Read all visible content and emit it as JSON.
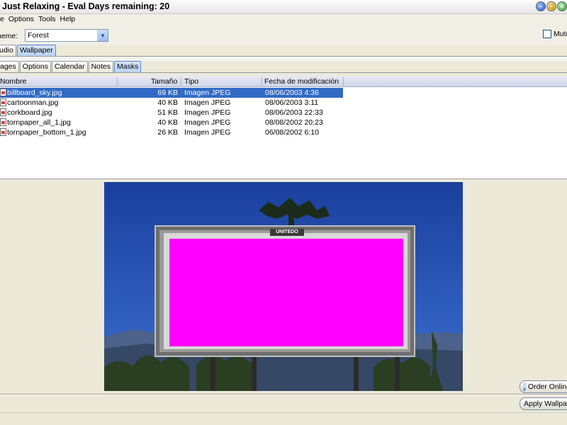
{
  "window": {
    "title": "Just Relaxing - Eval Days remaining: 20",
    "controls": {
      "minimize": "–",
      "maximize": "□",
      "close": "×"
    }
  },
  "menu": [
    {
      "label": "e",
      "accel": ""
    },
    {
      "label": "Options",
      "accel": "O"
    },
    {
      "label": "Tools",
      "accel": "T"
    },
    {
      "label": "Help",
      "accel": "H"
    }
  ],
  "theme": {
    "label": "heme:",
    "value": "Forest"
  },
  "mute": {
    "label": "Mute",
    "checked": false
  },
  "main_tabs": [
    {
      "label": "udio",
      "active": false
    },
    {
      "label": "Wallpaper",
      "active": true
    }
  ],
  "sub_tabs": [
    {
      "label": "ages",
      "active": false
    },
    {
      "label": "Options",
      "active": false
    },
    {
      "label": "Calendar",
      "active": false
    },
    {
      "label": "Notes",
      "active": false
    },
    {
      "label": "Masks",
      "active": true
    }
  ],
  "file_list": {
    "columns": {
      "name": "Nombre",
      "size": "Tamaño",
      "type": "Tipo",
      "modified": "Fecha de modificación"
    },
    "rows": [
      {
        "name": "billboard_sky.jpg",
        "size": "69 KB",
        "type": "Imagen JPEG",
        "modified": "08/06/2003 4:36",
        "selected": true
      },
      {
        "name": "cartoonman.jpg",
        "size": "40 KB",
        "type": "Imagen JPEG",
        "modified": "08/06/2003 3:11",
        "selected": false
      },
      {
        "name": "corkboard.jpg",
        "size": "51 KB",
        "type": "Imagen JPEG",
        "modified": "08/06/2003 22:33",
        "selected": false
      },
      {
        "name": "tornpaper_all_1.jpg",
        "size": "40 KB",
        "type": "Imagen JPEG",
        "modified": "08/08/2002 20:23",
        "selected": false
      },
      {
        "name": "tornpaper_bottom_1.jpg",
        "size": "26 KB",
        "type": "Imagen JPEG",
        "modified": "06/08/2002 6:10",
        "selected": false
      }
    ]
  },
  "preview": {
    "billboard_brand": "UNITEDO"
  },
  "buttons": {
    "order_online": "Order Online",
    "apply_wallpaper": "Apply Wallpaper"
  },
  "colors": {
    "selection": "#316ac5",
    "mask_fill": "#ff00ff",
    "sky": "#1f4aa8"
  }
}
